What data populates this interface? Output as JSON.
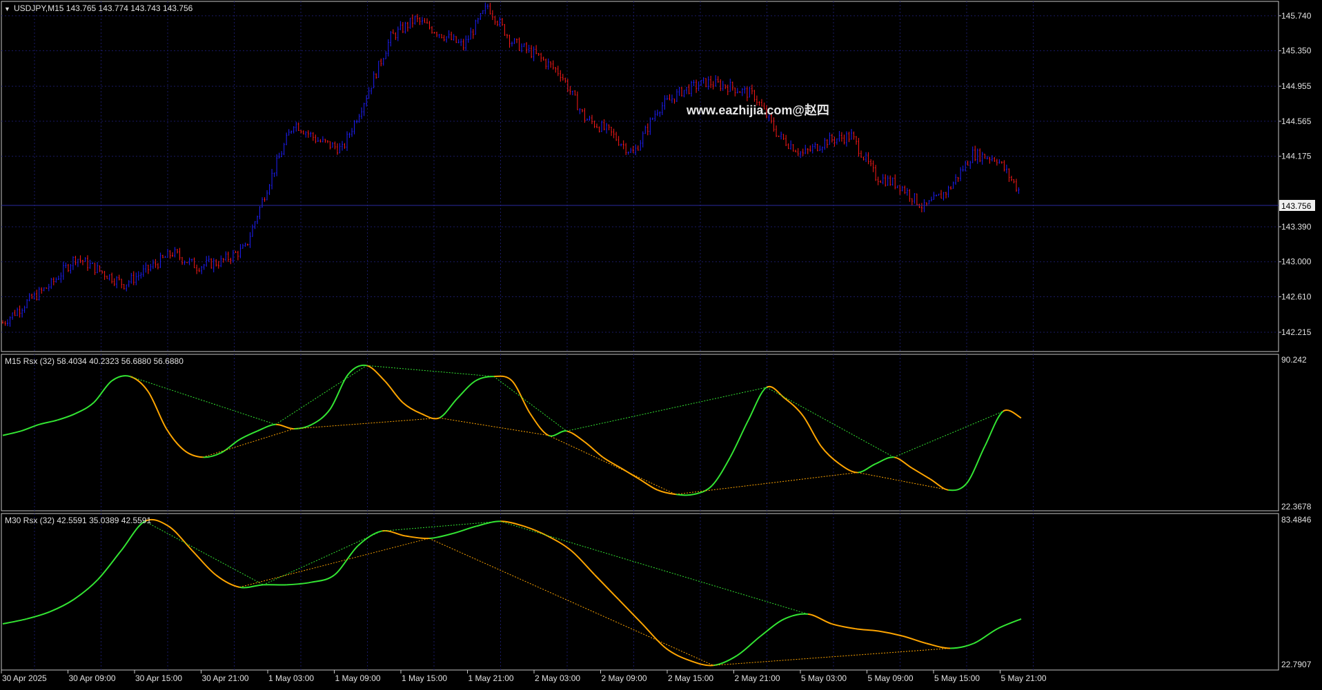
{
  "main_chart": {
    "symbol_caret": "▼",
    "header": "USDJPY,M15  143.765 143.774 143.743 143.756",
    "watermark": "www.eazhijia.com@赵四",
    "price_ticks": [
      "145.740",
      "145.350",
      "144.955",
      "144.565",
      "144.175",
      "143.390",
      "143.000",
      "142.610",
      "142.215"
    ],
    "current_price": "143.756",
    "colors": {
      "bull": "#1f1fff",
      "bear": "#ff1a1a",
      "grid": "#1a1a66",
      "price_line": "#2a2aa0"
    }
  },
  "indicator_m15": {
    "header": "M15  Rsx (32) 58.4034 40.2323 56.6880 56.6880",
    "max_label": "90.242",
    "min_label": "22.3678"
  },
  "indicator_m30": {
    "header": "M30  Rsx (32) 42.5591 35.0389 42.5591",
    "max_label": "83.4846",
    "min_label": "22.7907"
  },
  "time_axis": {
    "labels": [
      "30 Apr 2025",
      "30 Apr 09:00",
      "30 Apr 15:00",
      "30 Apr 21:00",
      "1 May 03:00",
      "1 May 09:00",
      "1 May 15:00",
      "1 May 21:00",
      "2 May 03:00",
      "2 May 09:00",
      "2 May 15:00",
      "2 May 21:00",
      "5 May 03:00",
      "5 May 09:00",
      "5 May 15:00",
      "5 May 21:00"
    ]
  },
  "chart_data": {
    "type": "line",
    "title": "USDJPY,M15",
    "ohlc_current": {
      "open": 143.765,
      "high": 143.774,
      "low": 143.743,
      "close": 143.756
    },
    "x": [
      "30 Apr 2025",
      "30 Apr 09:00",
      "30 Apr 15:00",
      "30 Apr 21:00",
      "1 May 03:00",
      "1 May 09:00",
      "1 May 15:00",
      "1 May 21:00",
      "2 May 03:00",
      "2 May 09:00",
      "2 May 15:00",
      "2 May 21:00",
      "5 May 03:00",
      "5 May 09:00",
      "5 May 15:00",
      "5 May 21:00"
    ],
    "price_ylim": [
      142.0,
      145.9
    ],
    "price_series": [
      {
        "values": [
          142.32,
          142.55,
          142.75,
          143.05,
          142.9,
          142.75,
          142.92,
          143.1,
          142.95,
          143.0,
          143.15,
          143.9,
          144.55,
          144.35,
          144.25,
          144.85,
          145.5,
          145.7,
          145.55,
          145.4,
          145.85,
          145.45,
          145.3,
          145.1,
          144.6,
          144.45,
          144.2,
          144.7,
          144.9,
          145.0,
          144.95,
          144.85,
          144.4,
          144.2,
          144.35,
          144.4,
          143.95,
          143.85,
          143.6,
          143.8,
          144.2,
          144.15,
          143.76
        ]
      }
    ],
    "indicators": [
      {
        "name": "M15 Rsx (32)",
        "ylim": [
          22.3678,
          90.242
        ],
        "legend_values": [
          58.4034,
          40.2323,
          56.688,
          56.688
        ],
        "series": [
          {
            "values": [
              55,
              57,
              60,
              62,
              65,
              70,
              80,
              82,
              75,
              58,
              48,
              45,
              47,
              53,
              57,
              60,
              58,
              60,
              67,
              83,
              87,
              80,
              70,
              65,
              63,
              72,
              80,
              82,
              80,
              65,
              55,
              57,
              52,
              45,
              40,
              35,
              30,
              28,
              28,
              32,
              45,
              62,
              77,
              72,
              64,
              50,
              42,
              38,
              42,
              45,
              40,
              35,
              30,
              33,
              50,
              66,
              63
            ]
          }
        ]
      },
      {
        "name": "M30 Rsx (32)",
        "ylim": [
          22.7907,
          83.4846
        ],
        "legend_values": [
          42.5591,
          35.0389,
          42.5591
        ],
        "series": [
          {
            "values": [
              40,
              42,
              45,
              50,
              58,
              70,
              82,
              80,
              70,
              60,
              55,
              56,
              56,
              57,
              60,
              72,
              78,
              76,
              75,
              77,
              80,
              82,
              80,
              76,
              70,
              60,
              50,
              40,
              30,
              25,
              23,
              27,
              35,
              42,
              44,
              40,
              38,
              37,
              35,
              32,
              30,
              32,
              38,
              42
            ]
          }
        ]
      }
    ]
  }
}
